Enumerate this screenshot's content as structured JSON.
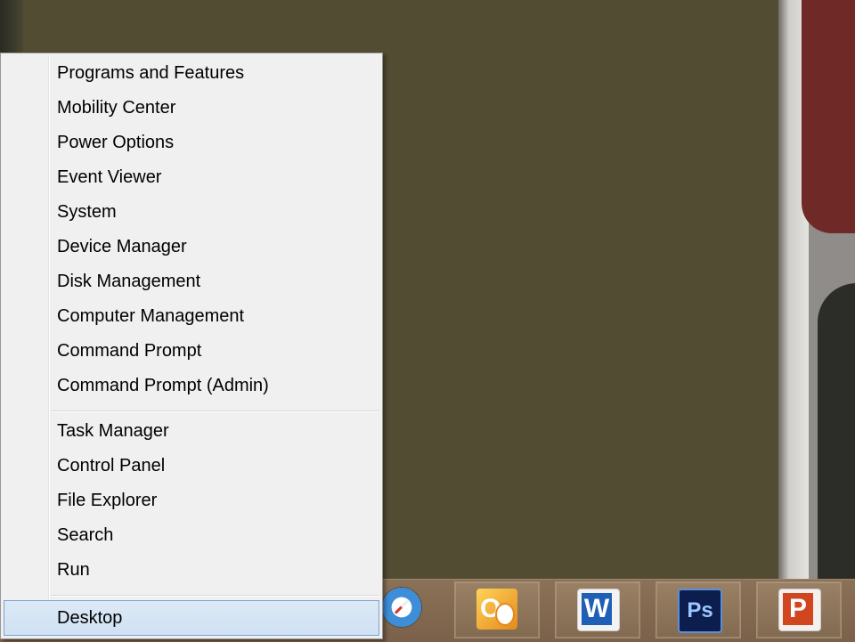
{
  "menu": {
    "group1": [
      {
        "label": "Programs and Features"
      },
      {
        "label": "Mobility Center"
      },
      {
        "label": "Power Options"
      },
      {
        "label": "Event Viewer"
      },
      {
        "label": "System"
      },
      {
        "label": "Device Manager"
      },
      {
        "label": "Disk Management"
      },
      {
        "label": "Computer Management"
      },
      {
        "label": "Command Prompt"
      },
      {
        "label": "Command Prompt (Admin)"
      }
    ],
    "group2": [
      {
        "label": "Task Manager"
      },
      {
        "label": "Control Panel"
      },
      {
        "label": "File Explorer"
      },
      {
        "label": "Search"
      },
      {
        "label": "Run"
      }
    ],
    "group3": [
      {
        "label": "Desktop",
        "highlighted": true
      }
    ]
  },
  "taskbar": {
    "apps": [
      {
        "icon": "safari-icon"
      },
      {
        "icon": "outlook-icon",
        "glyph": "O"
      },
      {
        "icon": "word-icon",
        "glyph": "W"
      },
      {
        "icon": "photoshop-icon",
        "glyph": "Ps"
      },
      {
        "icon": "powerpoint-icon",
        "glyph": "P"
      }
    ]
  }
}
